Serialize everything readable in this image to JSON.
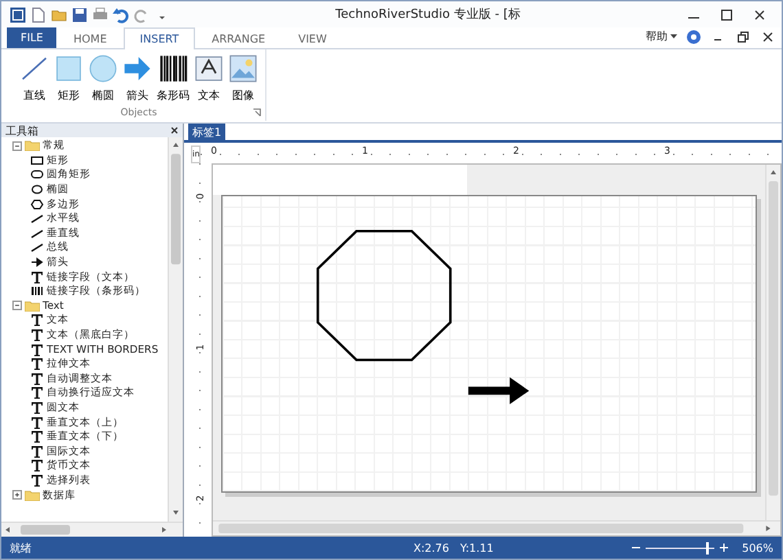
{
  "window": {
    "title": "TechnoRiverStudio 专业版 - [标",
    "help_menu": "帮助"
  },
  "ribbon": {
    "file_tab": "FILE",
    "tabs": [
      {
        "label": "HOME",
        "selected": false
      },
      {
        "label": "INSERT",
        "selected": true
      },
      {
        "label": "ARRANGE",
        "selected": false
      },
      {
        "label": "VIEW",
        "selected": false
      }
    ],
    "groups": [
      {
        "label": "Objects",
        "buttons": [
          {
            "kind": "line",
            "label": "直线"
          },
          {
            "kind": "rect",
            "label": "矩形"
          },
          {
            "kind": "ellipse",
            "label": "椭圆"
          },
          {
            "kind": "arrow",
            "label": "箭头"
          },
          {
            "kind": "barcode",
            "label": "条形码"
          },
          {
            "kind": "text",
            "label": "文本"
          },
          {
            "kind": "image",
            "label": "图像"
          }
        ]
      }
    ]
  },
  "toolbox": {
    "title": "工具箱",
    "tree": [
      {
        "kind": "folder",
        "label": "常规",
        "expanded": true,
        "children": [
          {
            "kind": "rect",
            "label": "矩形"
          },
          {
            "kind": "roundrect",
            "label": "圆角矩形"
          },
          {
            "kind": "ellipse",
            "label": "椭圆"
          },
          {
            "kind": "polygon",
            "label": "多边形"
          },
          {
            "kind": "line",
            "label": "水平线"
          },
          {
            "kind": "line",
            "label": "垂直线"
          },
          {
            "kind": "line",
            "label": "总线"
          },
          {
            "kind": "arrow",
            "label": "箭头"
          },
          {
            "kind": "text",
            "label": "链接字段（文本）"
          },
          {
            "kind": "barcode",
            "label": "链接字段（条形码）"
          }
        ]
      },
      {
        "kind": "folder",
        "label": "Text",
        "expanded": true,
        "children": [
          {
            "kind": "text",
            "label": "文本"
          },
          {
            "kind": "text",
            "label": "文本（黑底白字）"
          },
          {
            "kind": "text",
            "label": "TEXT WITH BORDERS"
          },
          {
            "kind": "text",
            "label": "拉伸文本"
          },
          {
            "kind": "text",
            "label": "自动调整文本"
          },
          {
            "kind": "text",
            "label": "自动换行适应文本"
          },
          {
            "kind": "text",
            "label": "圆文本"
          },
          {
            "kind": "text",
            "label": "垂直文本（上）"
          },
          {
            "kind": "text",
            "label": "垂直文本（下）"
          },
          {
            "kind": "text",
            "label": "国际文本"
          },
          {
            "kind": "text",
            "label": "货币文本"
          },
          {
            "kind": "text",
            "label": "选择列表"
          }
        ]
      },
      {
        "kind": "folder",
        "label": "数据库",
        "expanded": false
      }
    ]
  },
  "document_tabs": [
    {
      "label": "标签1",
      "selected": true
    }
  ],
  "ruler": {
    "unit": "in",
    "x_labels": [
      "0",
      "1",
      "2",
      "3"
    ],
    "y_labels": [
      "0",
      "1",
      "2"
    ]
  },
  "status_bar": {
    "status": "就绪",
    "x": "X:2.76",
    "y": "Y:1.11",
    "zoom": {
      "level": 0.88,
      "reading": "506%"
    }
  }
}
